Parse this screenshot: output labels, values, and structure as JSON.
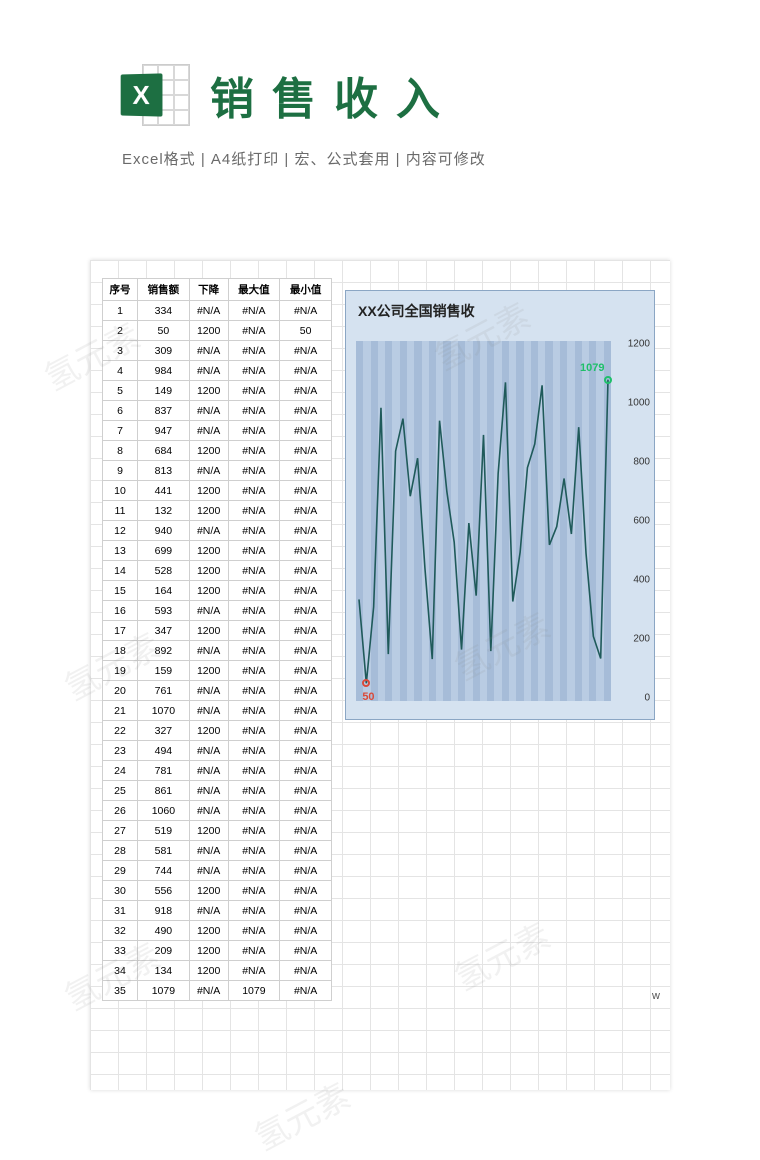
{
  "header": {
    "title": "销售收入",
    "subtitle": "Excel格式 |  A4纸打印 | 宏、公式套用 | 内容可修改",
    "icon_letter": "X"
  },
  "table": {
    "headers": [
      "序号",
      "销售额",
      "下降",
      "最大值",
      "最小值"
    ],
    "rows": [
      {
        "n": 1,
        "sales": 334,
        "down": "#N/A",
        "max": "#N/A",
        "min": "#N/A"
      },
      {
        "n": 2,
        "sales": 50,
        "down": "1200",
        "max": "#N/A",
        "min": "50"
      },
      {
        "n": 3,
        "sales": 309,
        "down": "#N/A",
        "max": "#N/A",
        "min": "#N/A"
      },
      {
        "n": 4,
        "sales": 984,
        "down": "#N/A",
        "max": "#N/A",
        "min": "#N/A"
      },
      {
        "n": 5,
        "sales": 149,
        "down": "1200",
        "max": "#N/A",
        "min": "#N/A"
      },
      {
        "n": 6,
        "sales": 837,
        "down": "#N/A",
        "max": "#N/A",
        "min": "#N/A"
      },
      {
        "n": 7,
        "sales": 947,
        "down": "#N/A",
        "max": "#N/A",
        "min": "#N/A"
      },
      {
        "n": 8,
        "sales": 684,
        "down": "1200",
        "max": "#N/A",
        "min": "#N/A"
      },
      {
        "n": 9,
        "sales": 813,
        "down": "#N/A",
        "max": "#N/A",
        "min": "#N/A"
      },
      {
        "n": 10,
        "sales": 441,
        "down": "1200",
        "max": "#N/A",
        "min": "#N/A"
      },
      {
        "n": 11,
        "sales": 132,
        "down": "1200",
        "max": "#N/A",
        "min": "#N/A"
      },
      {
        "n": 12,
        "sales": 940,
        "down": "#N/A",
        "max": "#N/A",
        "min": "#N/A"
      },
      {
        "n": 13,
        "sales": 699,
        "down": "1200",
        "max": "#N/A",
        "min": "#N/A"
      },
      {
        "n": 14,
        "sales": 528,
        "down": "1200",
        "max": "#N/A",
        "min": "#N/A"
      },
      {
        "n": 15,
        "sales": 164,
        "down": "1200",
        "max": "#N/A",
        "min": "#N/A"
      },
      {
        "n": 16,
        "sales": 593,
        "down": "#N/A",
        "max": "#N/A",
        "min": "#N/A"
      },
      {
        "n": 17,
        "sales": 347,
        "down": "1200",
        "max": "#N/A",
        "min": "#N/A"
      },
      {
        "n": 18,
        "sales": 892,
        "down": "#N/A",
        "max": "#N/A",
        "min": "#N/A"
      },
      {
        "n": 19,
        "sales": 159,
        "down": "1200",
        "max": "#N/A",
        "min": "#N/A"
      },
      {
        "n": 20,
        "sales": 761,
        "down": "#N/A",
        "max": "#N/A",
        "min": "#N/A"
      },
      {
        "n": 21,
        "sales": 1070,
        "down": "#N/A",
        "max": "#N/A",
        "min": "#N/A"
      },
      {
        "n": 22,
        "sales": 327,
        "down": "1200",
        "max": "#N/A",
        "min": "#N/A"
      },
      {
        "n": 23,
        "sales": 494,
        "down": "#N/A",
        "max": "#N/A",
        "min": "#N/A"
      },
      {
        "n": 24,
        "sales": 781,
        "down": "#N/A",
        "max": "#N/A",
        "min": "#N/A"
      },
      {
        "n": 25,
        "sales": 861,
        "down": "#N/A",
        "max": "#N/A",
        "min": "#N/A"
      },
      {
        "n": 26,
        "sales": 1060,
        "down": "#N/A",
        "max": "#N/A",
        "min": "#N/A"
      },
      {
        "n": 27,
        "sales": 519,
        "down": "1200",
        "max": "#N/A",
        "min": "#N/A"
      },
      {
        "n": 28,
        "sales": 581,
        "down": "#N/A",
        "max": "#N/A",
        "min": "#N/A"
      },
      {
        "n": 29,
        "sales": 744,
        "down": "#N/A",
        "max": "#N/A",
        "min": "#N/A"
      },
      {
        "n": 30,
        "sales": 556,
        "down": "1200",
        "max": "#N/A",
        "min": "#N/A"
      },
      {
        "n": 31,
        "sales": 918,
        "down": "#N/A",
        "max": "#N/A",
        "min": "#N/A"
      },
      {
        "n": 32,
        "sales": 490,
        "down": "1200",
        "max": "#N/A",
        "min": "#N/A"
      },
      {
        "n": 33,
        "sales": 209,
        "down": "1200",
        "max": "#N/A",
        "min": "#N/A"
      },
      {
        "n": 34,
        "sales": 134,
        "down": "1200",
        "max": "#N/A",
        "min": "#N/A"
      },
      {
        "n": 35,
        "sales": 1079,
        "down": "#N/A",
        "max": "1079",
        "min": "#N/A"
      }
    ]
  },
  "chart_data": {
    "type": "line",
    "title": "XX公司全国销售收",
    "x": [
      1,
      2,
      3,
      4,
      5,
      6,
      7,
      8,
      9,
      10,
      11,
      12,
      13,
      14,
      15,
      16,
      17,
      18,
      19,
      20,
      21,
      22,
      23,
      24,
      25,
      26,
      27,
      28,
      29,
      30,
      31,
      32,
      33,
      34,
      35
    ],
    "values": [
      334,
      50,
      309,
      984,
      149,
      837,
      947,
      684,
      813,
      441,
      132,
      940,
      699,
      528,
      164,
      593,
      347,
      892,
      159,
      761,
      1070,
      327,
      494,
      781,
      861,
      1060,
      519,
      581,
      744,
      556,
      918,
      490,
      209,
      134,
      1079
    ],
    "ylim": [
      0,
      1200
    ],
    "yticks": [
      0,
      200,
      400,
      600,
      800,
      1000,
      1200
    ],
    "max_marker": {
      "x": 35,
      "y": 1079,
      "label": "1079"
    },
    "min_marker": {
      "x": 2,
      "y": 50,
      "label": "50"
    }
  },
  "stray": "w",
  "watermark": "氢元素"
}
